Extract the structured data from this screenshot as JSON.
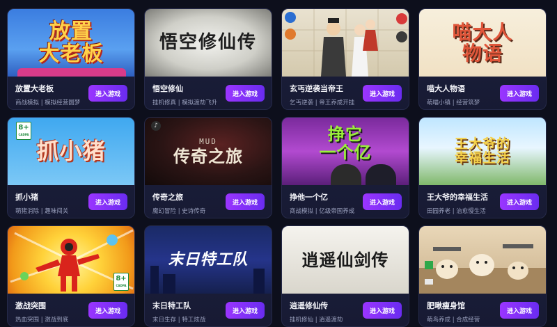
{
  "button_label": "进入游戏",
  "age_rating": "8+",
  "games": [
    {
      "thumb_text": "放置\n大老板",
      "name": "放置大老板",
      "tags": "商战模拟 | 模拟经营圆梦",
      "theme": "fangzhi"
    },
    {
      "thumb_text": "悟空修仙传",
      "name": "悟空修仙",
      "tags": "挂机修真 | 模拟渡劫飞升",
      "theme": "wukong"
    },
    {
      "thumb_text": "",
      "name": "玄丐逆袭当帝王",
      "tags": "乞丐逆袭 | 帝王养成开挂",
      "theme": "xuangai"
    },
    {
      "thumb_text": "喵大人\n物语",
      "name": "喵大人物语",
      "tags": "萌喵小镇 | 经营筑梦",
      "theme": "miao"
    },
    {
      "thumb_text": "抓小猪",
      "name": "抓小猪",
      "tags": "萌猪消除 | 趣味闯关",
      "theme": "zhuxiaozhu"
    },
    {
      "thumb_text": "传奇之旅",
      "name": "传奇之旅",
      "tags": "魔幻冒险 | 史诗传奇",
      "theme": "chuanqi",
      "sub": "MUD"
    },
    {
      "thumb_text": "挣它\n一个亿",
      "name": "挣他一个亿",
      "tags": "商战模拟 | 亿级帝国养成",
      "theme": "zheng"
    },
    {
      "thumb_text": "王大爷的\n幸福生活",
      "name": "王大爷的幸福生活",
      "tags": "田园养老 | 治愈慢生活",
      "theme": "wang"
    },
    {
      "thumb_text": "",
      "name": "激战突围",
      "tags": "热血突围 | 激战到底",
      "theme": "jizhan"
    },
    {
      "thumb_text": "末日特工队",
      "name": "末日特工队",
      "tags": "末日生存 | 特工炫战",
      "theme": "mori"
    },
    {
      "thumb_text": "逍遥仙剑传",
      "name": "逍遥修仙传",
      "tags": "挂机修仙 | 逍遥渡劫",
      "theme": "xiaoyao"
    },
    {
      "thumb_text": "",
      "name": "肥啾瘦身馆",
      "tags": "萌鸟养成 | 合成经营",
      "theme": "feijiu"
    }
  ]
}
